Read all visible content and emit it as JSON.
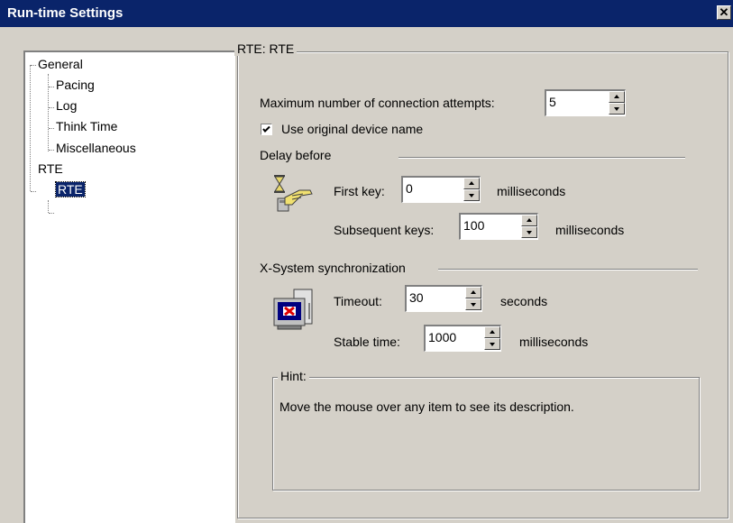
{
  "window": {
    "title": "Run-time Settings",
    "close_glyph": "✕"
  },
  "tree": {
    "items": [
      {
        "label": "General"
      },
      {
        "label": "Pacing"
      },
      {
        "label": "Log"
      },
      {
        "label": "Think Time"
      },
      {
        "label": "Miscellaneous"
      },
      {
        "label": "RTE"
      },
      {
        "label": "RTE",
        "selected": true
      }
    ]
  },
  "panel": {
    "title": "RTE: RTE",
    "max_conn_label": "Maximum number of connection attempts:",
    "max_conn_value": "5",
    "use_device_label": "Use original device name",
    "use_device_checked": true,
    "delay_title": "Delay before",
    "first_key_label": "First key:",
    "first_key_value": "0",
    "first_key_unit": "milliseconds",
    "subsequent_label": "Subsequent keys:",
    "subsequent_value": "100",
    "subsequent_unit": "milliseconds",
    "xsync_title": "X-System synchronization",
    "timeout_label": "Timeout:",
    "timeout_value": "30",
    "timeout_unit": "seconds",
    "stable_label": "Stable time:",
    "stable_value": "1000",
    "stable_unit": "milliseconds",
    "hint_title": "Hint:",
    "hint_text": "Move the mouse over any item to see its description."
  },
  "icons": {
    "delay": "hourglass-hand-icon",
    "xsync": "monitor-x-icon"
  }
}
